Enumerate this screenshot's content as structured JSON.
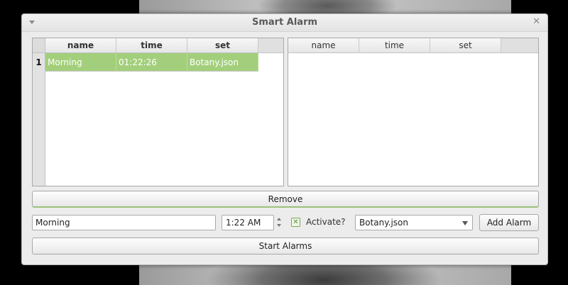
{
  "window": {
    "title": "Smart Alarm"
  },
  "left_table": {
    "columns": [
      "name",
      "time",
      "set"
    ],
    "rows": [
      {
        "num": "1",
        "name": "Morning",
        "time": "01:22:26",
        "set": "Botany.json"
      }
    ]
  },
  "right_table": {
    "columns": [
      "name",
      "time",
      "set"
    ]
  },
  "buttons": {
    "remove": "Remove",
    "add_alarm": "Add Alarm",
    "start_alarms": "Start Alarms"
  },
  "form": {
    "name_value": "Morning",
    "time_value": "1:22 AM",
    "activate_label": "Activate?",
    "activate_checked": true,
    "set_selected": "Botany.json"
  },
  "colors": {
    "selection": "#a3cf7c",
    "accent": "#9bc27a"
  }
}
